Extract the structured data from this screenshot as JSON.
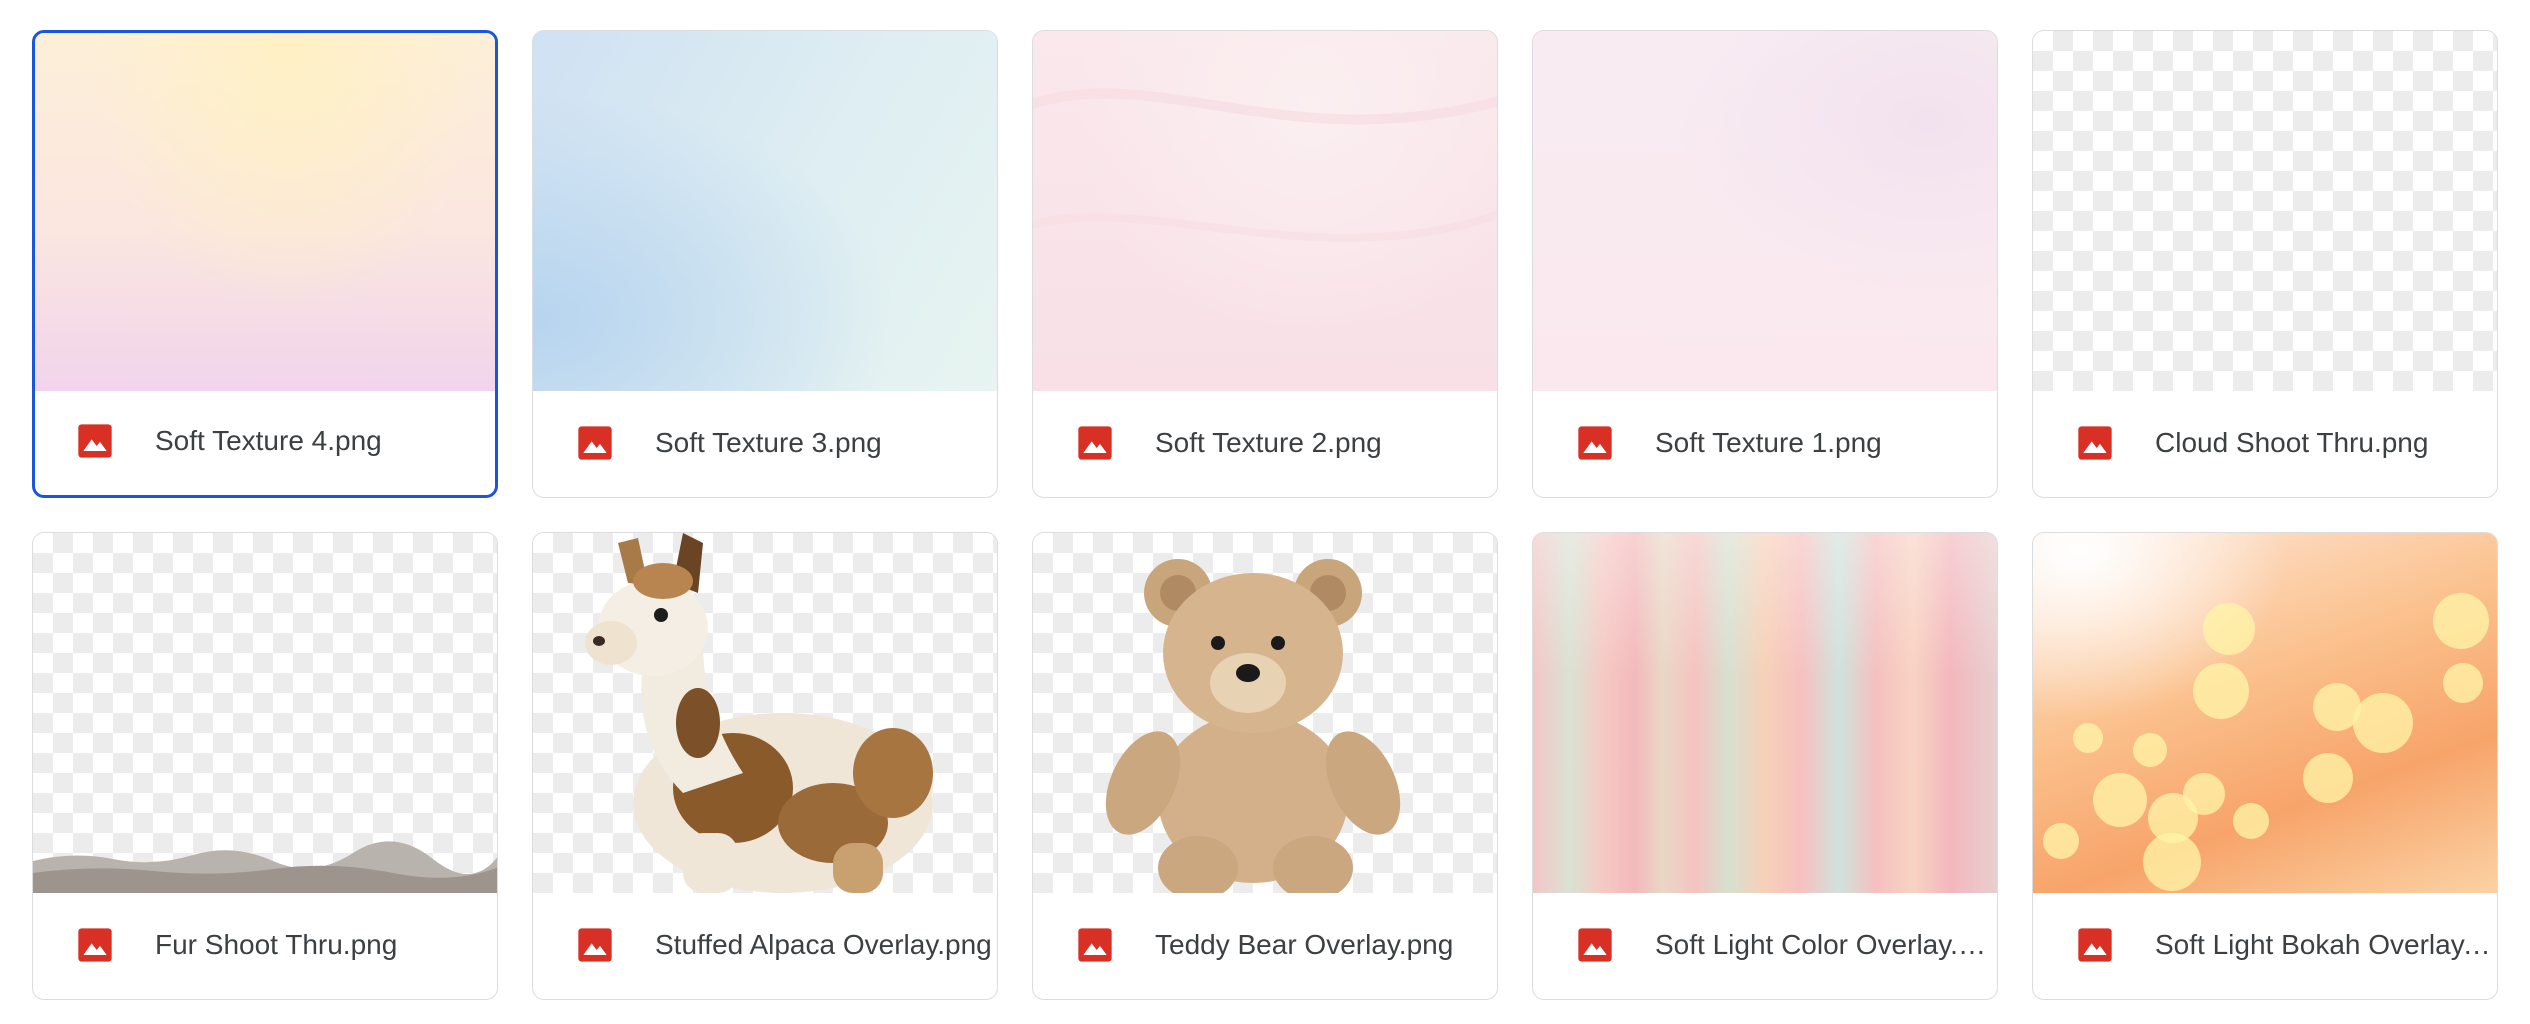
{
  "files": [
    {
      "name": "Soft Texture 4.png",
      "type_icon": "image-file-icon",
      "thumbnail": "soft-texture-yellow-pink",
      "selected": true
    },
    {
      "name": "Soft Texture 3.png",
      "type_icon": "image-file-icon",
      "thumbnail": "soft-texture-blue",
      "selected": false
    },
    {
      "name": "Soft Texture 2.png",
      "type_icon": "image-file-icon",
      "thumbnail": "soft-texture-pink",
      "selected": false
    },
    {
      "name": "Soft Texture 1.png",
      "type_icon": "image-file-icon",
      "thumbnail": "soft-texture-lilac",
      "selected": false
    },
    {
      "name": "Cloud Shoot Thru.png",
      "type_icon": "image-file-icon",
      "thumbnail": "transparent",
      "selected": false
    },
    {
      "name": "Fur Shoot Thru.png",
      "type_icon": "image-file-icon",
      "thumbnail": "transparent-fur-strip",
      "selected": false
    },
    {
      "name": "Stuffed Alpaca Overlay.png",
      "type_icon": "image-file-icon",
      "thumbnail": "stuffed-alpaca",
      "selected": false
    },
    {
      "name": "Teddy Bear Overlay.png",
      "type_icon": "image-file-icon",
      "thumbnail": "teddy-bear",
      "selected": false
    },
    {
      "name": "Soft Light Color Overlay.png",
      "type_icon": "image-file-icon",
      "thumbnail": "pastel-light-streaks",
      "selected": false
    },
    {
      "name": "Soft Light Bokah Overlay.png",
      "type_icon": "image-file-icon",
      "thumbnail": "orange-bokeh",
      "selected": false
    }
  ],
  "colors": {
    "image_icon": "#d93025",
    "selected_border": "#1a56db",
    "card_border": "#dadce0",
    "text": "#3c4043"
  }
}
